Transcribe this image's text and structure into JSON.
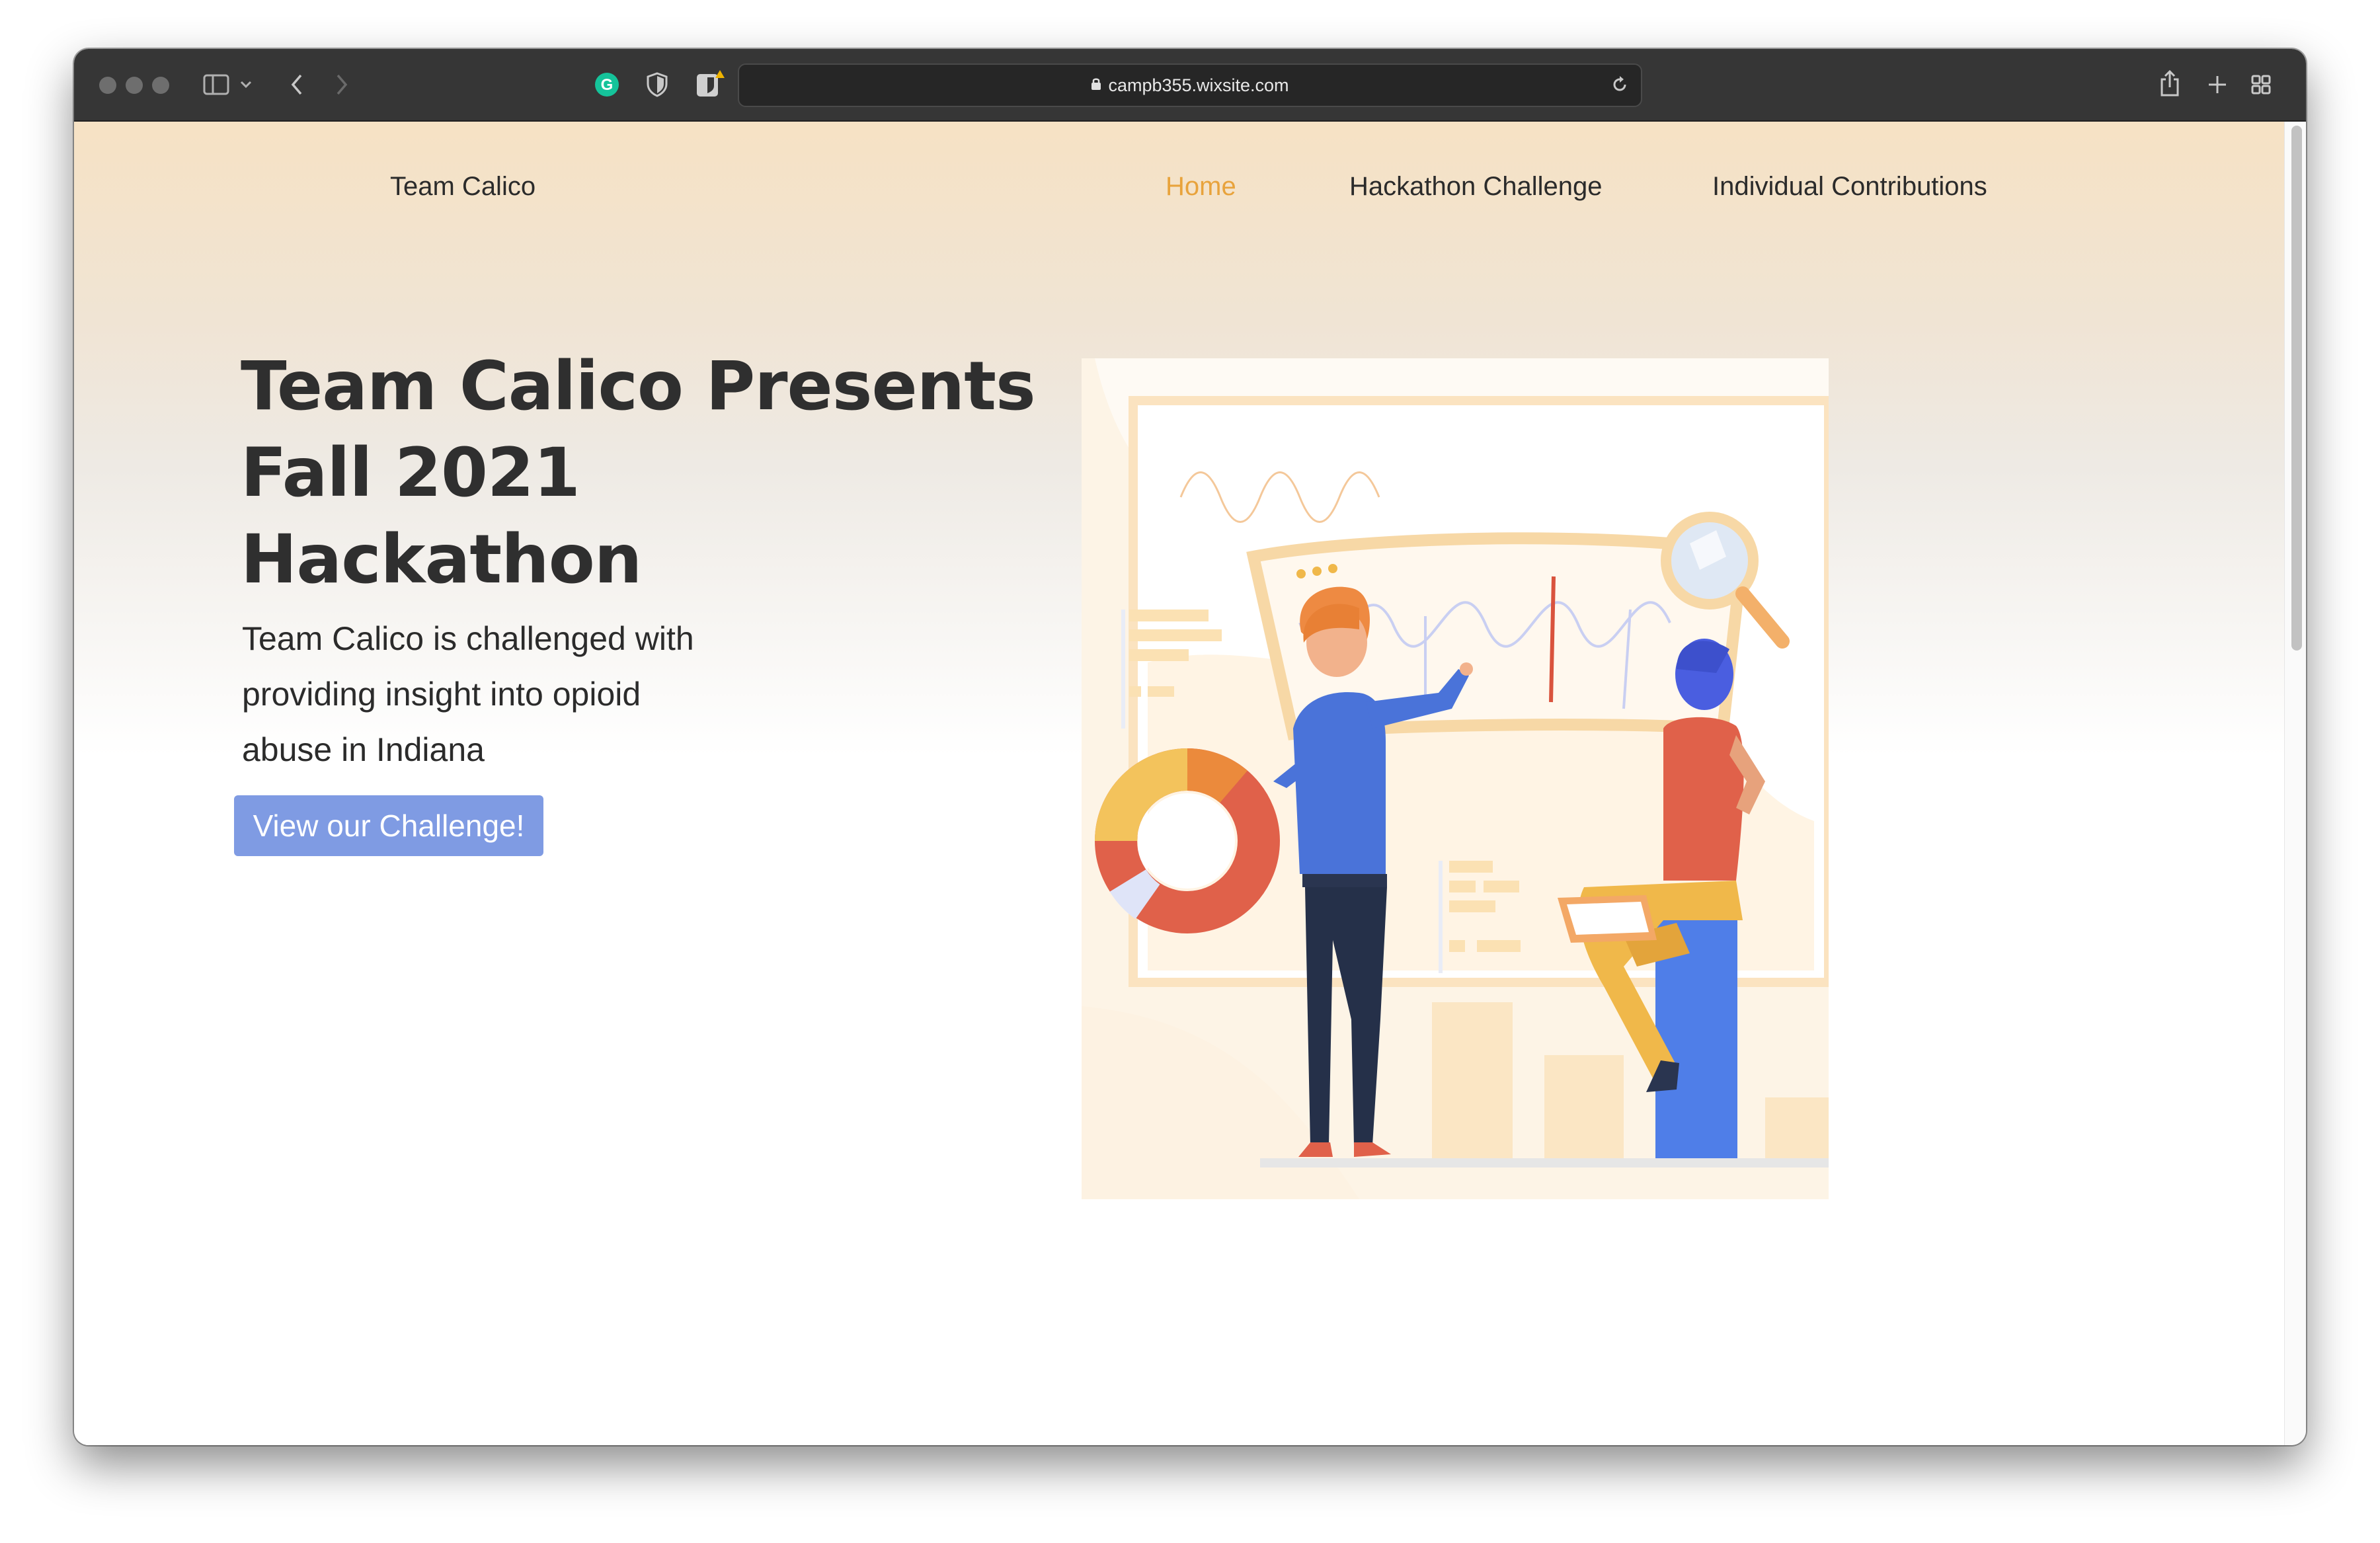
{
  "browser": {
    "url": "campb355.wixsite.com",
    "icons": [
      "sidebar-icon",
      "chevron-down-icon",
      "back-icon",
      "forward-icon",
      "grammarly-icon",
      "shield-icon",
      "bitwarden-icon",
      "lock-icon",
      "reload-icon",
      "share-icon",
      "new-tab-icon",
      "tab-overview-icon"
    ]
  },
  "site": {
    "name": "Team Calico",
    "nav": [
      {
        "label": "Home",
        "active": true
      },
      {
        "label": "Hackathon Challenge",
        "active": false
      },
      {
        "label": "Individual Contributions",
        "active": false
      }
    ]
  },
  "hero": {
    "title_lines": [
      "Team Calico Presents",
      "Fall 2021",
      "Hackathon"
    ],
    "subtitle_lines": [
      "Team Calico is challenged with",
      "providing insight into opioid",
      "abuse in Indiana"
    ],
    "cta_label": "View our Challenge!"
  },
  "colors": {
    "accent_nav": "#e8a33c",
    "cta": "#7f9be3",
    "header_bg": "#f6e2c4"
  }
}
